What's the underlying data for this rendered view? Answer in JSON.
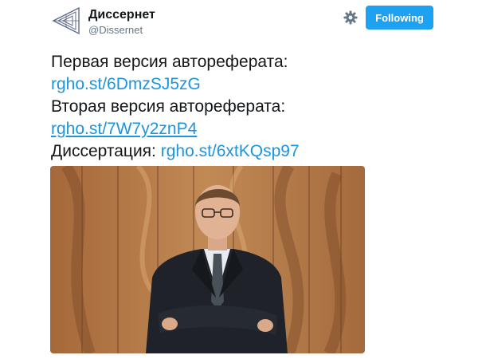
{
  "account": {
    "display_name": "Диссернет",
    "handle": "@Dissernet",
    "avatar_icon": "dissernet-logo-icon"
  },
  "actions": {
    "settings_icon": "gear-icon",
    "follow_label": "Following",
    "follow_color": "#1da1f2"
  },
  "tweet": {
    "line1": "Первая версия автореферата:",
    "link1": "rgho.st/6DmzSJ5zG",
    "line2": "Вторая версия автореферата:",
    "link2": "rgho.st/7W7y2znP4",
    "line3_prefix": "Диссертация: ",
    "link3": "rgho.st/6xtKQsp97",
    "link_color": "#1b95e0"
  },
  "media": {
    "kind": "photo"
  }
}
